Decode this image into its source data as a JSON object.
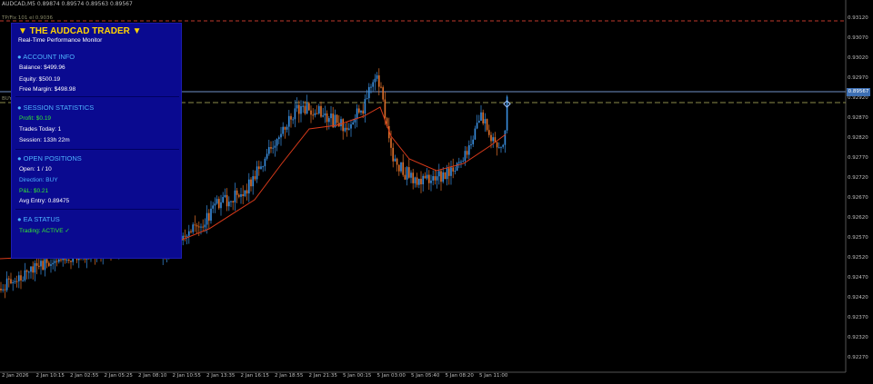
{
  "header_text": "AUDCAD,M5 0.89874 0.89574 0.89563 0.89567",
  "level_labels": {
    "tp": "TP/Fix 101 el 0.9036",
    "buy": "BUY 0.01 at 0.89475"
  },
  "y_axis": [
    "0.93120",
    "0.93070",
    "0.93020",
    "0.92970",
    "0.92920",
    "0.92870",
    "0.92820",
    "0.92770",
    "0.92720",
    "0.92670",
    "0.92620",
    "0.92570",
    "0.92520",
    "0.92470",
    "0.92420",
    "0.92370",
    "0.92320",
    "0.92270"
  ],
  "current_price": "0.89567",
  "x_axis": [
    "2 Jan 2026",
    "2 Jan 10:15",
    "2 Jan 02:55",
    "2 Jan 05:25",
    "2 Jan 08:10",
    "2 Jan 10:55",
    "2 Jan 13:35",
    "2 Jan 16:15",
    "2 Jan 18:55",
    "2 Jan 21:35",
    "5 Jan 00:15",
    "5 Jan 03:00",
    "5 Jan 05:40",
    "5 Jan 08:20",
    "5 Jan 11:00"
  ],
  "colors": {
    "bull": "#3a8fe0",
    "bear": "#e0702a",
    "ma": "#d83a1a",
    "tp_line": "#c0392b",
    "buy_line": "#8c8c4a",
    "price_line": "#6f8fc8",
    "panel_bg": "#0a0a90"
  },
  "panel": {
    "title": "▼ THE AUDCAD TRADER ▼",
    "subtitle": "Real-Time Performance Monitor",
    "account": {
      "header": "● ACCOUNT INFO",
      "balance": "Balance: $499.96",
      "equity": "Equity: $500.19",
      "free_margin": "Free Margin: $498.98"
    },
    "session": {
      "header": "● SESSION STATISTICS",
      "profit": "Profit: $0.19",
      "trades": "Trades Today: 1",
      "session": "Session: 133h 22m"
    },
    "positions": {
      "header": "● OPEN POSITIONS",
      "open": "Open: 1 / 10",
      "direction": "Direction: BUY",
      "pl": "P&L: $0.21",
      "avg_entry": "Avg Entry: 0.89475"
    },
    "status": {
      "header": "● EA STATUS",
      "trading": "Trading: ACTIVE ✓"
    }
  }
}
